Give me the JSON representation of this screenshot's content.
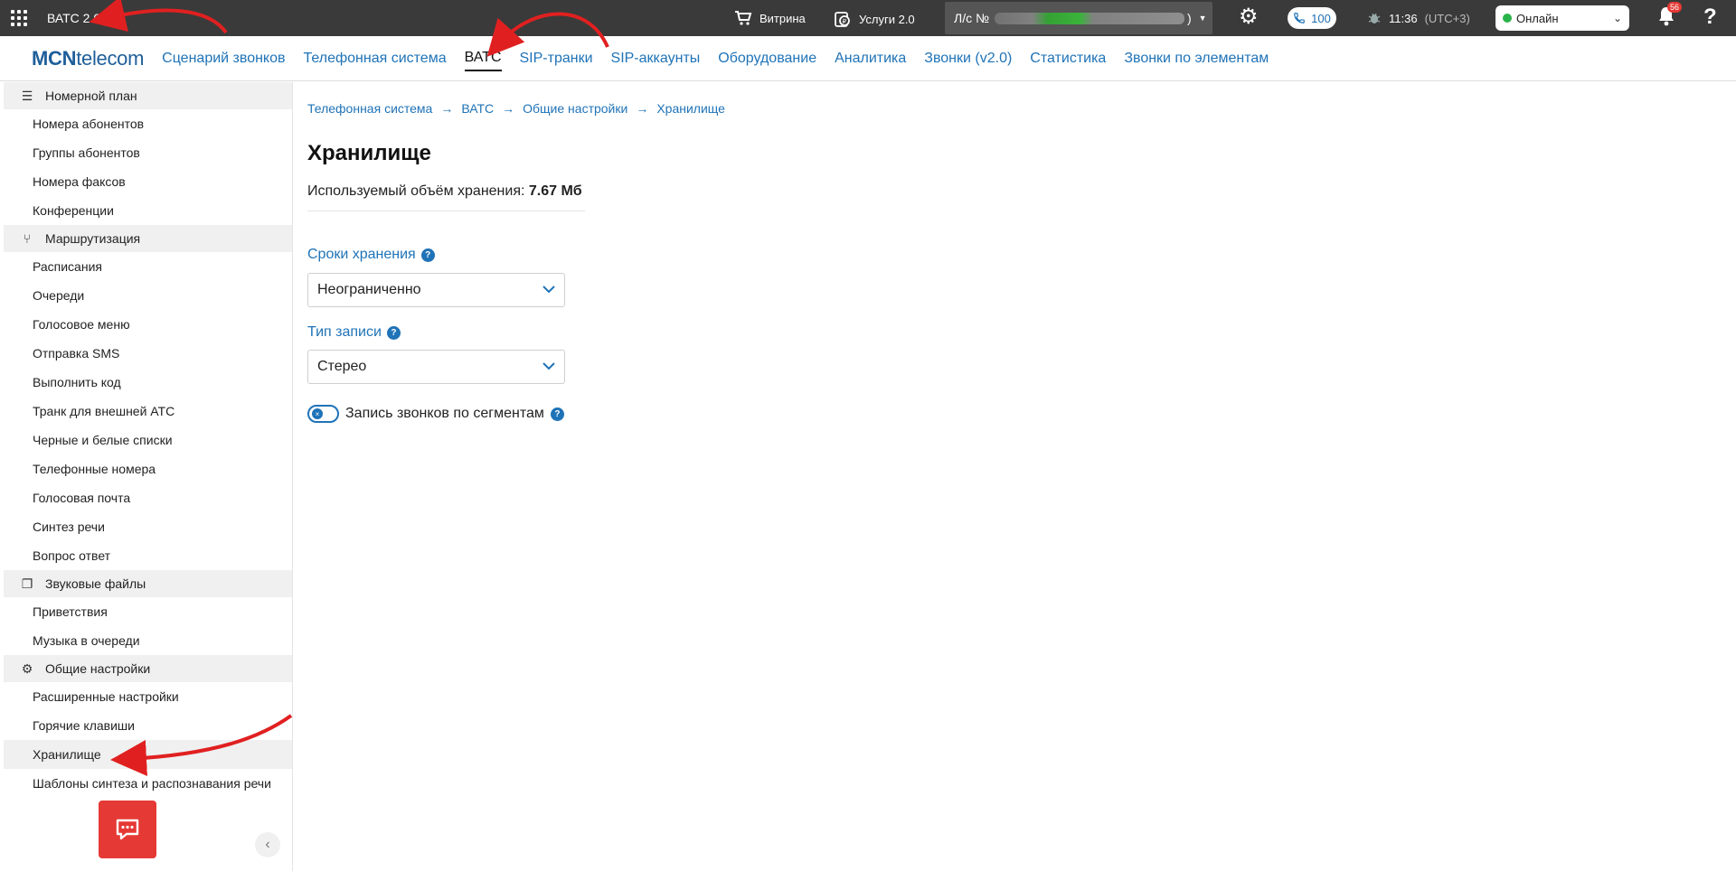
{
  "topbar": {
    "app_title": "ВАТС 2.0",
    "storefront_label": "Витрина",
    "services_label": "Услуги 2.0",
    "account_prefix": "Л/с №",
    "account_suffix": ")",
    "calls_count": "100",
    "time": "11:36",
    "timezone": "(UTC+3)",
    "status": "Онлайн",
    "notifications_count": "56",
    "help": "?"
  },
  "nav": {
    "logo_bold": "MCN",
    "logo_rest": "telecom",
    "items": [
      "Сценарий звонков",
      "Телефонная система",
      "ВАТС",
      "SIP-транки",
      "SIP-аккаунты",
      "Оборудование",
      "Аналитика",
      "Звонки (v2.0)",
      "Статистика",
      "Звонки по элементам"
    ],
    "active": "ВАТС"
  },
  "sidebar": {
    "sections": [
      {
        "title": "Номерной план",
        "icon": "list-icon",
        "items": [
          "Номера абонентов",
          "Группы абонентов",
          "Номера факсов",
          "Конференции"
        ]
      },
      {
        "title": "Маршрутизация",
        "icon": "routing-icon",
        "items": [
          "Расписания",
          "Очереди",
          "Голосовое меню",
          "Отправка SMS",
          "Выполнить код",
          "Транк для внешней АТС",
          "Черные и белые списки",
          "Телефонные номера",
          "Голосовая почта",
          "Синтез речи",
          "Вопрос ответ"
        ]
      },
      {
        "title": "Звуковые файлы",
        "icon": "audio-files-icon",
        "items": [
          "Приветствия",
          "Музыка в очереди"
        ]
      },
      {
        "title": "Общие настройки",
        "icon": "gear-icon",
        "items": [
          "Расширенные настройки",
          "Горячие клавиши",
          "Хранилище",
          "Шаблоны синтеза и распознавания речи"
        ]
      }
    ],
    "active_item": "Хранилище"
  },
  "main": {
    "breadcrumb": [
      "Телефонная система",
      "ВАТС",
      "Общие настройки",
      "Хранилище"
    ],
    "title": "Хранилище",
    "usage_label": "Используемый объём хранения:",
    "usage_value": "7.67 Мб",
    "retention_label": "Сроки хранения",
    "retention_value": "Неограниченно",
    "record_type_label": "Тип записи",
    "record_type_value": "Стерео",
    "segment_toggle_label": "Запись звонков по сегментам",
    "segment_toggle_on": false
  },
  "colors": {
    "accent": "#1f73b7",
    "topbar_bg": "#3a3a3a",
    "chat_button": "#e53935",
    "annotation_arrow": "#e02020"
  }
}
